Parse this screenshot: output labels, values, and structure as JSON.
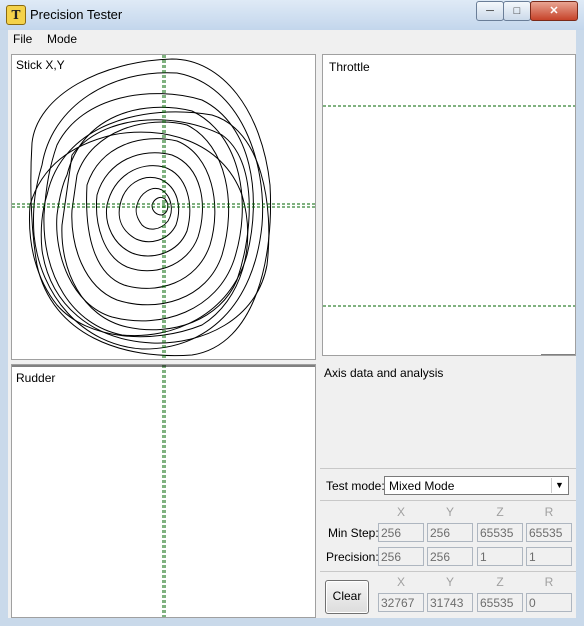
{
  "window": {
    "title": "Precision Tester",
    "icon_glyph": "T",
    "min_label": "─",
    "max_label": "□",
    "close_label": "✕"
  },
  "menu": [
    {
      "label": "File"
    },
    {
      "label": "Mode"
    }
  ],
  "panels": {
    "stick": "Stick X,Y",
    "throttle": "Throttle",
    "rudder": "Rudder"
  },
  "info": {
    "label": "Axis data and analysis"
  },
  "test_mode": {
    "label": "Test mode:",
    "value": "Mixed Mode"
  },
  "stats": {
    "headers": [
      "X",
      "Y",
      "Z",
      "R"
    ],
    "min_step": {
      "label": "Min Step:",
      "values": [
        "256",
        "256",
        "65535",
        "65535"
      ]
    },
    "precision": {
      "label": "Precision:",
      "values": [
        "256",
        "256",
        "1",
        "1"
      ]
    }
  },
  "current": {
    "headers": [
      "X",
      "Y",
      "Z",
      "R"
    ],
    "values": [
      "32767",
      "31743",
      "65535",
      "0"
    ],
    "clear_label": "Clear"
  },
  "colors": {
    "guide": "#006600",
    "trace": "#000000"
  }
}
